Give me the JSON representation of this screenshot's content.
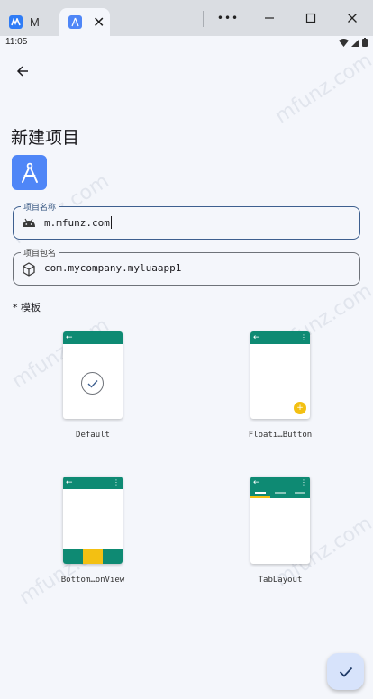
{
  "window": {
    "tabs": [
      {
        "label": "M",
        "icon": "app-icon"
      },
      {
        "label": "",
        "icon": "android-studio-icon",
        "close": "✕"
      }
    ],
    "controls": {
      "menu": "•••",
      "minimize": "minimize-icon",
      "maximize": "maximize-icon",
      "close": "close-icon"
    }
  },
  "status_bar": {
    "time": "11:05"
  },
  "page": {
    "title": "新建项目",
    "project_name": {
      "label": "项目名称",
      "value": "m.mfunz.com",
      "icon": "android-icon"
    },
    "package_name": {
      "label": "项目包名",
      "value": "com.mycompany.myluaapp1",
      "icon": "package-icon"
    },
    "templates_label": "* 模板",
    "templates": [
      {
        "name": "Default",
        "kind": "default",
        "selected": true
      },
      {
        "name": "Floati…Button",
        "kind": "fab"
      },
      {
        "name": "Bottom…onView",
        "kind": "bottom-nav"
      },
      {
        "name": "TabLayout",
        "kind": "tabs"
      }
    ]
  },
  "watermark": "mfunz.com",
  "colors": {
    "accent": "#0e8a73",
    "highlight": "#f3c012",
    "primary": "#4f86f7",
    "fab": "#d7e3fb"
  }
}
